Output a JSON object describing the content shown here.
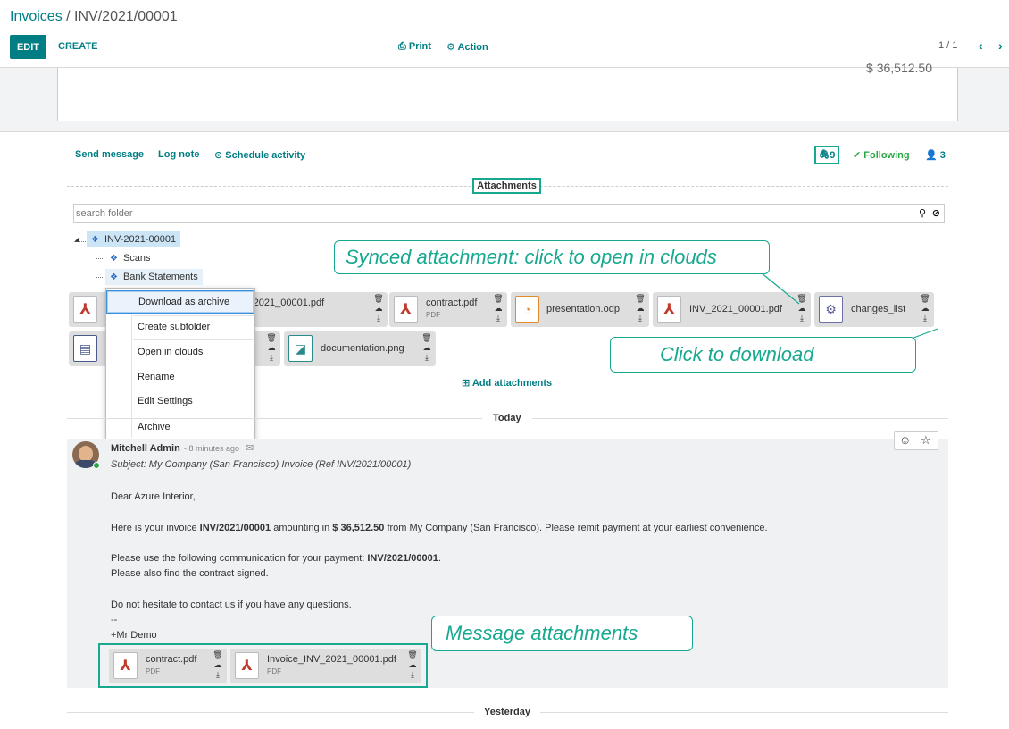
{
  "breadcrumb": {
    "parent": "Invoices",
    "sep": " / ",
    "current": "INV/2021/00001"
  },
  "toolbar": {
    "edit": "EDIT",
    "create": "CREATE",
    "print": "Print",
    "action": "Action",
    "pager": "1 / 1"
  },
  "sheet": {
    "amount_partial": "$ 36,512.50"
  },
  "chatter": {
    "send_message": "Send message",
    "log_note": "Log note",
    "schedule_activity": "Schedule activity",
    "attachments_count": "9",
    "following": "Following",
    "followers": "3"
  },
  "attachments_panel": {
    "title": "Attachments",
    "search_placeholder": "search folder",
    "tree": {
      "root": "INV-2021-00001",
      "children": [
        "Scans",
        "Bank Statements"
      ]
    },
    "files": [
      {
        "name": "Invoice_INV_2021_00001.pdf",
        "visible_name": "e_INV_2021_00001.pdf",
        "type": ""
      },
      {
        "name": "contract.pdf",
        "type": "PDF"
      },
      {
        "name": "presentation.odp",
        "type": ""
      },
      {
        "name": "INV_2021_00001.pdf",
        "type": ""
      },
      {
        "name": "changes_list",
        "type": ""
      },
      {
        "name": "",
        "type": ""
      },
      {
        "name": "documentation.png",
        "type": ""
      }
    ],
    "add_attachments": "Add attachments"
  },
  "context_menu": [
    "Download as archive",
    "Create subfolder",
    "Open in clouds",
    "Rename",
    "Edit Settings",
    "Archive"
  ],
  "callouts": {
    "synced": "Synced attachment: click to open in clouds",
    "download": "Click to download",
    "message_attachments": "Message attachments"
  },
  "thread": {
    "today": "Today",
    "yesterday": "Yesterday",
    "message": {
      "author": "Mitchell Admin",
      "time": "- 8 minutes ago",
      "subject": "Subject: My Company (San Francisco) Invoice (Ref INV/2021/00001)",
      "greeting": "Dear Azure Interior,",
      "line1_a": "Here is your invoice ",
      "line1_ref": "INV/2021/00001",
      "line1_b": " amounting in ",
      "line1_amount": "$ 36,512.50",
      "line1_c": " from My Company (San Francisco). Please remit payment at your earliest convenience.",
      "line2_a": "Please use the following communication for your payment: ",
      "line2_ref": "INV/2021/00001",
      "line2_b": ".",
      "line3": "Please also find the contract signed.",
      "line4": "Do not hesitate to contact us if you have any questions.",
      "sig_sep": "--",
      "signature": "+Mr Demo",
      "attachments": [
        {
          "name": "contract.pdf",
          "type": "PDF"
        },
        {
          "name": "Invoice_INV_2021_00001.pdf",
          "type": "PDF"
        }
      ]
    }
  },
  "colors": {
    "primary": "#017e84",
    "annotation": "#17a98f",
    "pdf": "#c0392b",
    "tree_selected": "#cbe5f7"
  }
}
